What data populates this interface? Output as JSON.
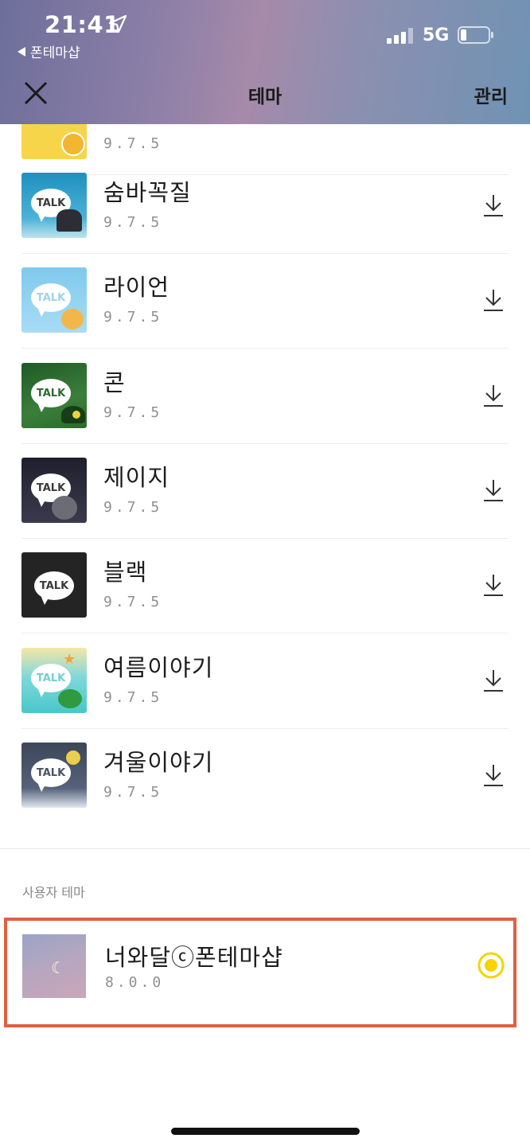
{
  "status_bar": {
    "time": "21:41",
    "back_app": "폰테마샵",
    "network": "5G"
  },
  "header": {
    "title": "테마",
    "manage_label": "관리"
  },
  "themes": [
    {
      "name": "",
      "version": "9.7.5",
      "thumb_bg": "#f7d54a",
      "bubble_text": ""
    },
    {
      "name": "숨바꼭질",
      "version": "9.7.5",
      "thumb_bg": "#3fa1c7",
      "bubble_text": "TALK"
    },
    {
      "name": "라이언",
      "version": "9.7.5",
      "thumb_bg": "#8fd0ef",
      "bubble_text": "TALK"
    },
    {
      "name": "콘",
      "version": "9.7.5",
      "thumb_bg": "#2e6a33",
      "bubble_text": "TALK"
    },
    {
      "name": "제이지",
      "version": "9.7.5",
      "thumb_bg": "#2b2b3a",
      "bubble_text": "TALK"
    },
    {
      "name": "블랙",
      "version": "9.7.5",
      "thumb_bg": "#222222",
      "bubble_text": "TALK"
    },
    {
      "name": "여름이야기",
      "version": "9.7.5",
      "thumb_bg": "#7fd8da",
      "bubble_text": "TALK"
    },
    {
      "name": "겨울이야기",
      "version": "9.7.5",
      "thumb_bg": "#495365",
      "bubble_text": "TALK"
    }
  ],
  "user_section": {
    "label": "사용자 테마",
    "item": {
      "name": "너와달ⓒ폰테마샵",
      "version": "8.0.0",
      "selected": true
    }
  },
  "colors": {
    "accent_yellow": "#f5d400",
    "highlight_border": "#e0603e"
  },
  "icons": {
    "close": "close-icon",
    "download": "download-icon",
    "radio": "radio-selected-icon"
  }
}
